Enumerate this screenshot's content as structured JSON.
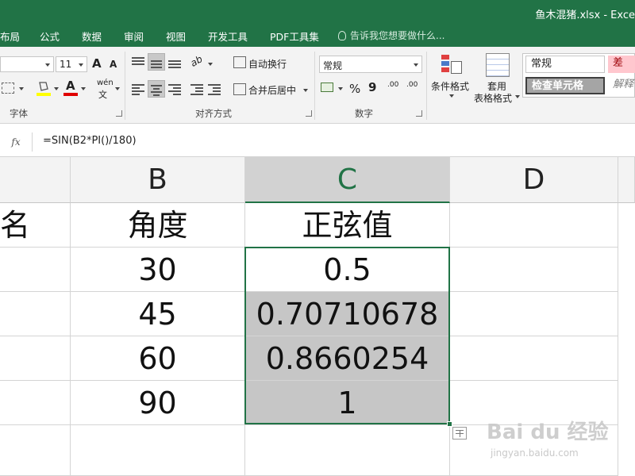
{
  "window": {
    "title": "鱼木混猪.xlsx - Exce"
  },
  "menu": {
    "items": [
      "布局",
      "公式",
      "数据",
      "审阅",
      "视图",
      "开发工具",
      "PDF工具集"
    ],
    "tell_me": "告诉我您想要做什么..."
  },
  "ribbon": {
    "font": {
      "size": "11",
      "grow_label": "A",
      "shrink_label": "A",
      "font_color_label": "A",
      "phonetic_label": "wén",
      "group_label": "字体"
    },
    "alignment": {
      "wrap_text": "自动换行",
      "merge_center": "合并后居中",
      "orientation_label": "ab",
      "group_label": "对齐方式"
    },
    "number": {
      "format": "常规",
      "percent": "%",
      "comma": "9",
      "inc_decimal": ".00",
      "dec_decimal": ".00",
      "group_label": "数字"
    },
    "styles": {
      "conditional_formatting": "条件格式",
      "format_as_table_line1": "套用",
      "format_as_table_line2": "表格格式",
      "normal": "常规",
      "bad": "差",
      "check_cell": "检查单元格",
      "explanatory": "解释"
    }
  },
  "formula_bar": {
    "fx": "fx",
    "formula": "=SIN(B2*PI()/180)"
  },
  "sheet": {
    "columns": [
      "B",
      "C",
      "D"
    ],
    "col_a_partial": [
      "名",
      "",
      "",
      "",
      ""
    ],
    "col_b": [
      "角度",
      "30",
      "45",
      "60",
      "90"
    ],
    "col_c": [
      "正弦值",
      "0.5",
      "0.70710678",
      "0.8660254",
      "1"
    ]
  },
  "watermark": {
    "main": "Bai du 经验",
    "sub": "jingyan.baidu.com"
  },
  "colors": {
    "accent": "#217346",
    "selection": "#c6c6c6"
  }
}
